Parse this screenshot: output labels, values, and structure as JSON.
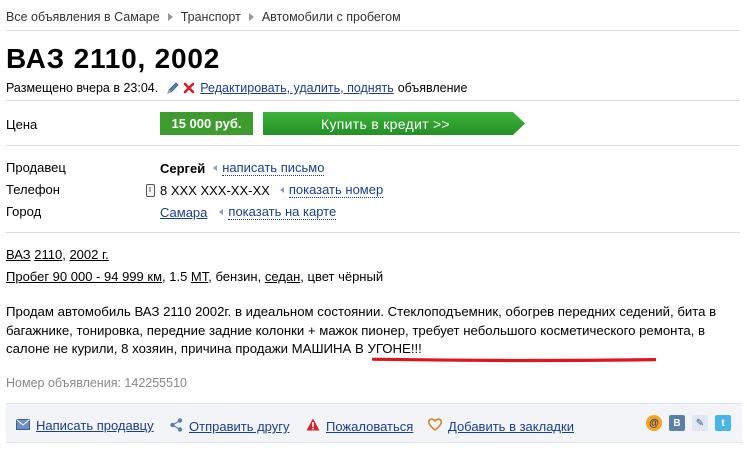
{
  "breadcrumb": [
    "Все объявления в Самаре",
    "Транспорт",
    "Автомобили с пробегом"
  ],
  "title": "ВАЗ 2110, 2002",
  "posted": {
    "text": "Размещено вчера в 23:04.",
    "edit_link": "Редактировать, удалить, поднять",
    "tail": "объявление"
  },
  "price": {
    "label": "Цена",
    "value": "15 000 руб.",
    "credit_button": "Купить в кредит >>"
  },
  "seller": {
    "label": "Продавец",
    "name": "Сергей",
    "write_link": "написать письмо"
  },
  "phone": {
    "label": "Телефон",
    "masked": "8 XXX XXX-XX-XX",
    "show_link": "показать номер"
  },
  "city": {
    "label": "Город",
    "name": "Самара",
    "map_link": "показать на карте"
  },
  "specs": {
    "make": "ВАЗ",
    "model": "2110",
    "year": "2002 г.",
    "mileage": "Пробег 90 000 - 94 999 км",
    "engine": ", 1.5 ",
    "transmission": "МТ",
    "fuel": ", бензин, ",
    "body": "седан",
    "color": ", цвет чёрный"
  },
  "description": {
    "main": "Продам автомобиль ВАЗ 2110 2002г. в идеальном состоянии. Стеклоподъемник, обогрев передних седений, бита в багажнике, тонировка, передние задние колонки + мажок пионер, требует небольшого косметического ремонта, в салоне не курили, 8 хозяин, ",
    "highlight": "причина продажи МАШИНА В УГОНЕ!!!"
  },
  "ad_number": "Номер объявления: 142255510",
  "actions": {
    "write_seller": "Написать продавцу",
    "send_friend": "Отправить другу",
    "complain": "Пожаловаться",
    "bookmark": "Добавить в закладки"
  },
  "social": [
    "@",
    "В",
    "✎",
    "t"
  ],
  "colors": {
    "link": "#1a3e8c",
    "price_green": "#3e9b2e",
    "credit_green": "#2f9e2f",
    "underline_red": "#e0141e"
  },
  "icons": [
    "pencil-icon",
    "x-icon",
    "phone-icon",
    "envelope-icon",
    "share-icon",
    "warning-icon",
    "heart-icon",
    "mail-ru-icon",
    "vkontakte-icon",
    "livejournal-icon",
    "twitter-icon"
  ]
}
